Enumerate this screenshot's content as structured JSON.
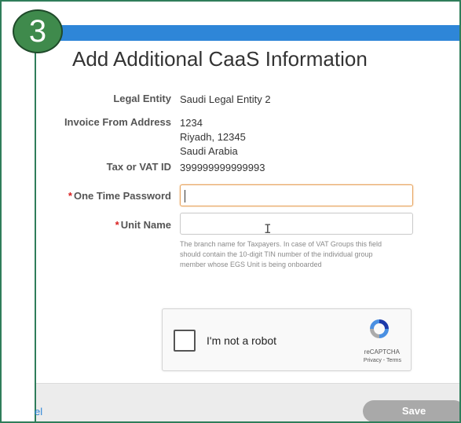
{
  "step_badge": "3",
  "dialog": {
    "title": "Add Additional CaaS Information",
    "legal_entity": {
      "label": "Legal Entity",
      "value": "Saudi Legal Entity 2"
    },
    "invoice_from_address": {
      "label": "Invoice From Address",
      "lines": [
        "1234",
        "Riyadh, 12345",
        "Saudi Arabia"
      ]
    },
    "tax_vat_id": {
      "label": "Tax or VAT ID",
      "value": "399999999999993"
    },
    "one_time_password": {
      "required_mark": "*",
      "label": "One Time Password",
      "value": ""
    },
    "unit_name": {
      "required_mark": "*",
      "label": "Unit Name",
      "value": "",
      "help": "The branch name for Taxpayers. In case of VAT Groups this field should contain the 10-digit TIN number of the individual group member whose EGS Unit is being onboarded"
    },
    "recaptcha": {
      "checkbox_label": "I'm not a robot",
      "brand": "reCAPTCHA",
      "privacy": "Privacy",
      "separator": " - ",
      "terms": "Terms",
      "checked": false
    },
    "footer": {
      "cancel_label": "el",
      "save_label": "Save"
    }
  },
  "colors": {
    "accent_bar": "#2e86d8",
    "badge": "#3f8a4c",
    "frame": "#2f7d5a",
    "focus": "#e7a35c",
    "required": "#d92020",
    "save_disabled": "#a9a9a9"
  }
}
